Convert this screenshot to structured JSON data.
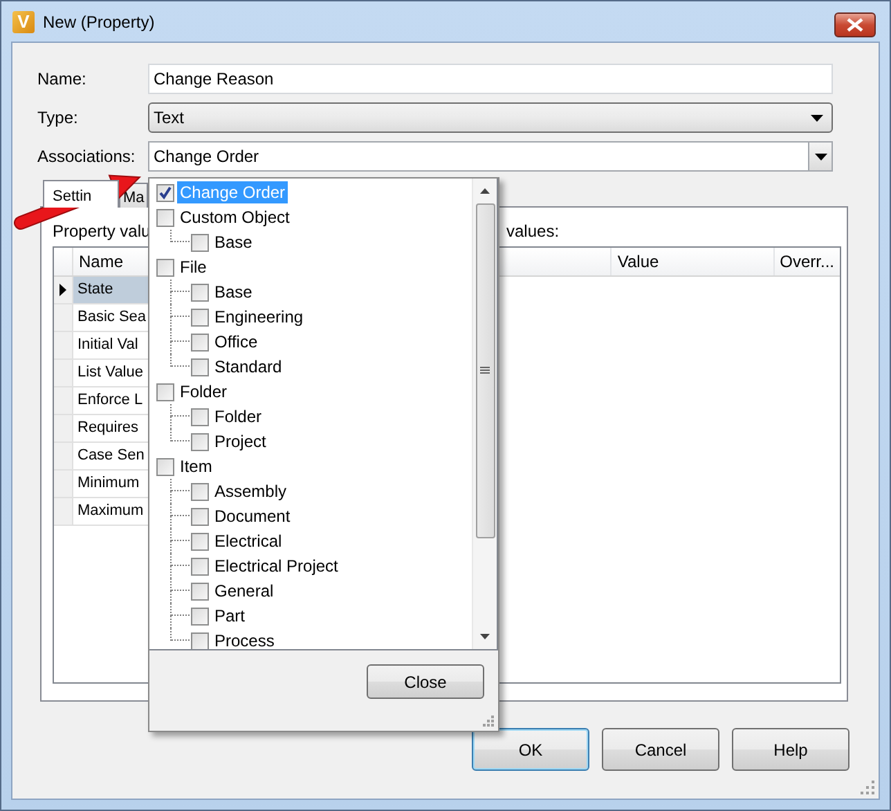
{
  "window": {
    "title": "New (Property)",
    "icon_letter": "V"
  },
  "fields": [
    {
      "label": "Name:",
      "kind": "text",
      "value": "Change Reason"
    },
    {
      "label": "Type:",
      "kind": "select",
      "value": "Text"
    },
    {
      "label": "Associations:",
      "kind": "combo",
      "value": "Change Order"
    }
  ],
  "tabs": [
    {
      "label": "Settin",
      "selected": true
    },
    {
      "label": "Ma",
      "selected": false
    }
  ],
  "panel": {
    "caption_left": "Property valu",
    "caption_right": "values:"
  },
  "grid": {
    "columns": [
      "Name",
      "Value",
      "Overr..."
    ],
    "rows": [
      {
        "name": "State",
        "selected": true
      },
      {
        "name": "Basic Sea",
        "selected": false
      },
      {
        "name": "Initial Val",
        "selected": false
      },
      {
        "name": "List Value",
        "selected": false
      },
      {
        "name": "Enforce L",
        "selected": false
      },
      {
        "name": "Requires",
        "selected": false
      },
      {
        "name": "Case Sen",
        "selected": false
      },
      {
        "name": "Minimum",
        "selected": false
      },
      {
        "name": "Maximum",
        "selected": false
      }
    ]
  },
  "popup": {
    "items": [
      {
        "label": "Change Order",
        "checked": true,
        "selected": true
      },
      {
        "label": "Custom Object",
        "checked": false,
        "selected": false,
        "children": [
          {
            "label": "Base",
            "checked": false,
            "selected": false
          }
        ]
      },
      {
        "label": "File",
        "checked": false,
        "selected": false,
        "children": [
          {
            "label": "Base",
            "checked": false,
            "selected": false
          },
          {
            "label": "Engineering",
            "checked": false,
            "selected": false
          },
          {
            "label": "Office",
            "checked": false,
            "selected": false
          },
          {
            "label": "Standard",
            "checked": false,
            "selected": false
          }
        ]
      },
      {
        "label": "Folder",
        "checked": false,
        "selected": false,
        "children": [
          {
            "label": "Folder",
            "checked": false,
            "selected": false
          },
          {
            "label": "Project",
            "checked": false,
            "selected": false
          }
        ]
      },
      {
        "label": "Item",
        "checked": false,
        "selected": false,
        "children": [
          {
            "label": "Assembly",
            "checked": false,
            "selected": false
          },
          {
            "label": "Document",
            "checked": false,
            "selected": false
          },
          {
            "label": "Electrical",
            "checked": false,
            "selected": false
          },
          {
            "label": "Electrical Project",
            "checked": false,
            "selected": false
          },
          {
            "label": "General",
            "checked": false,
            "selected": false
          },
          {
            "label": "Part",
            "checked": false,
            "selected": false
          },
          {
            "label": "Process",
            "checked": false,
            "selected": false
          }
        ]
      }
    ],
    "close_button": "Close"
  },
  "buttons": [
    {
      "label": "OK",
      "default": true
    },
    {
      "label": "Cancel",
      "default": false
    },
    {
      "label": "Help",
      "default": false
    }
  ]
}
